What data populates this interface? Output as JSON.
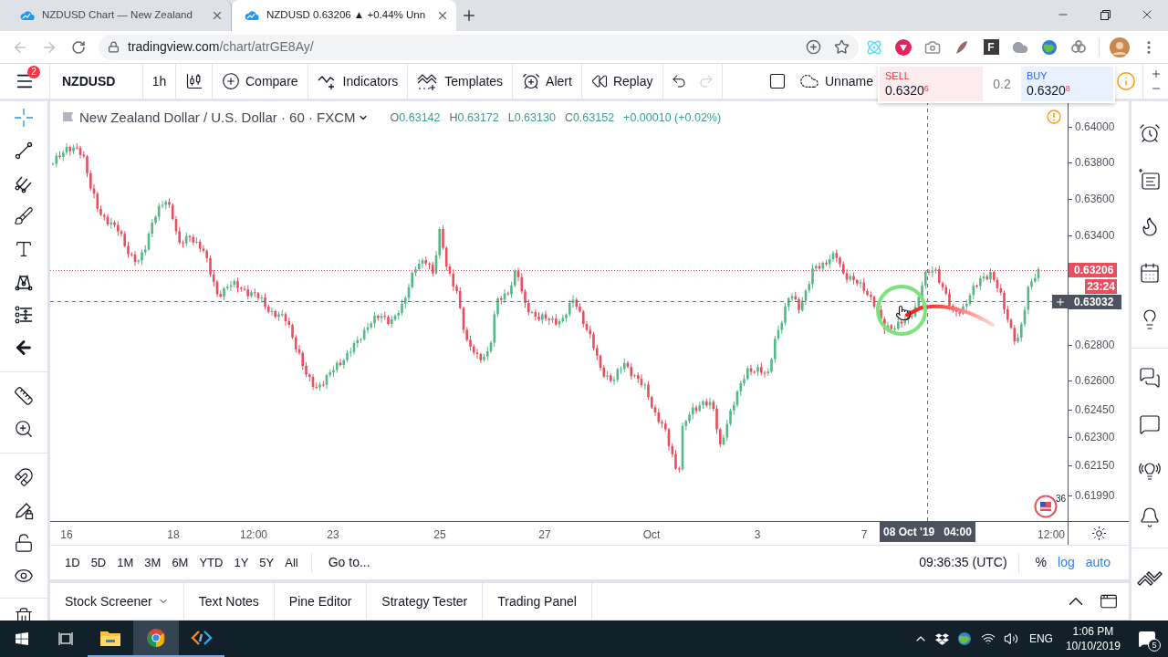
{
  "browser": {
    "tabs": [
      {
        "title": "NZDUSD Chart — New Zealand",
        "selected": false
      },
      {
        "title": "NZDUSD 0.63206 ▲ +0.44% Unn",
        "selected": true
      }
    ],
    "address": {
      "host": "tradingview.com",
      "path": "/chart/atrGE8Ay/"
    },
    "extension_letter": "F"
  },
  "toolbar": {
    "menu_badge": "2",
    "symbol": "NZDUSD",
    "interval": "1h",
    "actions": [
      {
        "kind": "compare",
        "label": "Compare"
      },
      {
        "kind": "indicators",
        "label": "Indicators"
      },
      {
        "kind": "templates",
        "label": "Templates"
      },
      {
        "kind": "alert",
        "label": "Alert"
      },
      {
        "kind": "replay",
        "label": "Replay"
      }
    ],
    "layout_name": "Unname"
  },
  "order_panel": {
    "sell": {
      "label": "SELL",
      "price": "0.6320$^{6}$"
    },
    "spread": "0.2",
    "buy": {
      "label": "BUY",
      "price": "0.6320$^{8}$"
    }
  },
  "drawing_tool_groups": [
    {
      "tools": [
        {
          "kind": "crosshair",
          "selected": true
        },
        {
          "kind": "trend_line",
          "selected": false
        },
        {
          "kind": "pitchfork",
          "selected": false
        },
        {
          "kind": "brush",
          "selected": false
        },
        {
          "kind": "text",
          "selected": false
        },
        {
          "kind": "pattern",
          "selected": false
        },
        {
          "kind": "projection",
          "selected": false
        },
        {
          "kind": "back",
          "selected": false
        }
      ]
    },
    {
      "tools": [
        {
          "kind": "ruler",
          "selected": false
        },
        {
          "kind": "zoom",
          "selected": false
        }
      ]
    },
    {
      "tools": [
        {
          "kind": "magnet",
          "selected": false
        },
        {
          "kind": "drawing_lock",
          "selected": false
        },
        {
          "kind": "lock",
          "selected": false
        },
        {
          "kind": "visibility",
          "selected": false
        }
      ]
    },
    {
      "tools": [
        {
          "kind": "trash",
          "selected": false
        }
      ]
    }
  ],
  "chart": {
    "title": "New Zealand Dollar / U.S. Dollar · 60 · FXCM",
    "ohlc": [
      {
        "label": "O",
        "value": "0.63142"
      },
      {
        "label": "H",
        "value": "0.63172"
      },
      {
        "label": "L",
        "value": "0.63130"
      },
      {
        "label": "C",
        "value": "0.63152"
      }
    ],
    "change": "+0.00010 (+0.02%)",
    "price_axis": [
      "0.64000",
      "0.63800",
      "0.63600",
      "0.63400",
      "0.62800",
      "0.62600",
      "0.62450",
      "0.62300",
      "0.62150",
      "0.61990"
    ],
    "last_price": "0.63206",
    "countdown": "23:24",
    "crosshair_price": "0.63032",
    "event_count": "36",
    "time_axis": [
      "16",
      "18",
      "12:00",
      "23",
      "25",
      "27",
      "Oct",
      "3",
      "7",
      "12:00"
    ],
    "crosshair_date": "08 Oct '19",
    "crosshair_time": "04:00"
  },
  "range_bar": {
    "ranges": [
      "1D",
      "5D",
      "1M",
      "3M",
      "6M",
      "YTD",
      "1Y",
      "5Y",
      "All"
    ],
    "goto": "Go to...",
    "clock": "09:36:35 (UTC)",
    "scale_options": [
      {
        "label": "%",
        "on": false
      },
      {
        "label": "log",
        "on": true
      },
      {
        "label": "auto",
        "on": true
      }
    ]
  },
  "bottom_tabs": [
    {
      "label": "Stock Screener",
      "menu": true
    },
    {
      "label": "Text Notes",
      "menu": false
    },
    {
      "label": "Pine Editor",
      "menu": false
    },
    {
      "label": "Strategy Tester",
      "menu": false
    },
    {
      "label": "Trading Panel",
      "menu": false
    }
  ],
  "taskbar": {
    "apps": [
      {
        "kind": "folder",
        "selected": false
      },
      {
        "kind": "browser",
        "selected": true
      },
      {
        "kind": "code",
        "selected": false
      }
    ],
    "language": "ENG",
    "time": "1:06 PM",
    "date": "10/10/2019",
    "notifications": "5"
  }
}
